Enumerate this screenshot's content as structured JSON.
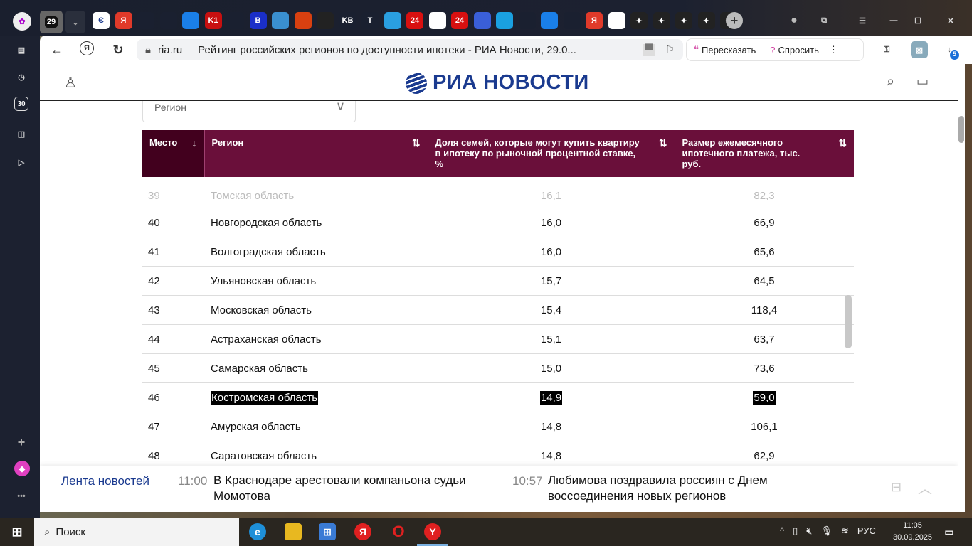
{
  "browser": {
    "tab_counter": "29",
    "url_domain": "ria.ru",
    "page_title": "Рейтинг российских регионов по доступности ипотеки - РИА Новости, 29.0...",
    "retell_label": "Пересказать",
    "ask_label": "Спросить",
    "downloads_badge": "5",
    "sidebar_calendar": "30",
    "tabs": [
      "Є",
      "Я",
      "",
      "",
      "",
      "K1",
      "",
      "B",
      "",
      "",
      "",
      "KB",
      "T",
      "",
      "24",
      "",
      "24",
      "",
      "",
      "",
      "",
      "",
      "Я",
      "",
      "",
      "",
      "",
      "",
      ""
    ]
  },
  "header": {
    "logo": "РИА НОВОСТИ"
  },
  "filter": {
    "placeholder": "Регион"
  },
  "table": {
    "headers": [
      "Место",
      "Регион",
      "Доля семей, которые могут купить квартиру в ипотеку по рыночной процентной ставке, %",
      "Размер ежемесячного ипотечного платежа, тыс. руб."
    ],
    "partial_top": [
      "39",
      "Томская область",
      "16,1",
      "82,3"
    ],
    "rows": [
      [
        "40",
        "Новгородская область",
        "16,0",
        "66,9"
      ],
      [
        "41",
        "Волгоградская область",
        "16,0",
        "65,6"
      ],
      [
        "42",
        "Ульяновская область",
        "15,7",
        "64,5"
      ],
      [
        "43",
        "Московская область",
        "15,4",
        "118,4"
      ],
      [
        "44",
        "Астраханская область",
        "15,1",
        "63,7"
      ],
      [
        "45",
        "Самарская область",
        "15,0",
        "73,6"
      ],
      [
        "46",
        "Костромская область",
        "14,9",
        "59,0"
      ],
      [
        "47",
        "Амурская область",
        "14,8",
        "106,1"
      ],
      [
        "48",
        "Саратовская область",
        "14,8",
        "62,9"
      ]
    ],
    "highlighted_row": "46"
  },
  "news": {
    "label": "Лента новостей",
    "items": [
      {
        "time": "11:00",
        "text": "В Краснодаре арестовали компаньона судьи Момотова"
      },
      {
        "time": "10:57",
        "text": "Любимова поздравила россиян с Днем воссоединения новых регионов"
      }
    ]
  },
  "taskbar": {
    "search": "Поиск",
    "lang": "РУС",
    "time": "11:05",
    "date": "30.09.2025"
  },
  "colors": {
    "header_bg": "#6a0f3a",
    "header_first": "#42001e",
    "brand": "#1a3a8f"
  }
}
